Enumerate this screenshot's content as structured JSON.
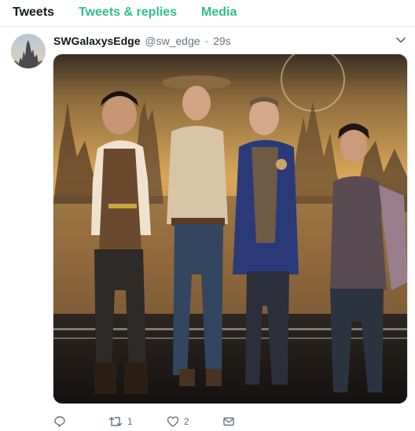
{
  "tabs": [
    {
      "label": "Tweets",
      "active": true
    },
    {
      "label": "Tweets & replies",
      "active": false
    },
    {
      "label": "Media",
      "active": false
    }
  ],
  "tweet": {
    "display_name": "SWGalaxysEdge",
    "handle": "@sw_edge",
    "separator": "·",
    "time": "29s",
    "menu_icon": "chevron-down-icon",
    "image_description_icon": "photo",
    "actions": {
      "reply_count": "",
      "retweet_count": "1",
      "like_count": "2"
    }
  },
  "colors": {
    "accent": "#2ec08b",
    "muted": "#657786",
    "border": "#e6ecf0"
  }
}
